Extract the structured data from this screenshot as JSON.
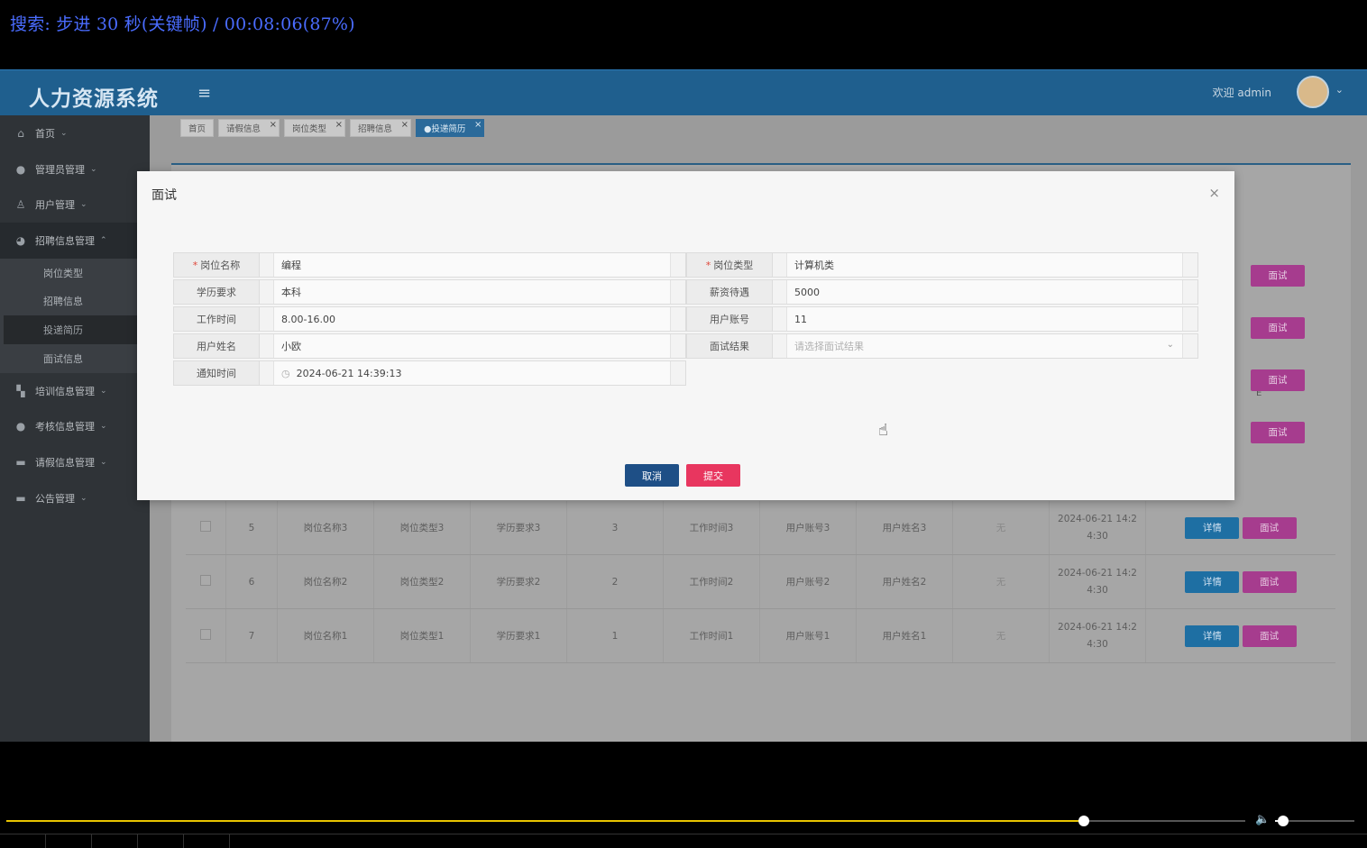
{
  "player": {
    "osd_text": "搜索: 步进 30 秒(关键帧) / 00:08:06(87%)",
    "progress": 0.87,
    "volume": 0.1
  },
  "app": {
    "brand": "人力资源系统",
    "welcome": "欢迎 admin"
  },
  "sidebar": {
    "items": [
      {
        "label": "首页",
        "icon": "home-icon"
      },
      {
        "label": "管理员管理",
        "icon": "admin-icon"
      },
      {
        "label": "用户管理",
        "icon": "user-icon"
      },
      {
        "label": "招聘信息管理",
        "icon": "recruit-icon"
      },
      {
        "label": "培训信息管理",
        "icon": "training-icon"
      },
      {
        "label": "考核信息管理",
        "icon": "assessment-icon"
      },
      {
        "label": "请假信息管理",
        "icon": "leave-icon"
      },
      {
        "label": "公告管理",
        "icon": "notice-icon"
      }
    ],
    "submenu": [
      "岗位类型",
      "招聘信息",
      "投递简历",
      "面试信息"
    ]
  },
  "tabs": [
    {
      "label": "首页"
    },
    {
      "label": "请假信息"
    },
    {
      "label": "岗位类型"
    },
    {
      "label": "招聘信息"
    },
    {
      "label": "●投递简历"
    }
  ],
  "table": {
    "header_fragment": "E",
    "rows": [
      {
        "id": "5",
        "name": "岗位名称3",
        "type": "岗位类型3",
        "edu": "学历要求3",
        "salary": "3",
        "time": "工作时间3",
        "account": "用户账号3",
        "uname": "用户姓名3",
        "status": "无",
        "date1": "2024-06-21 14:2",
        "date2": "4:30"
      },
      {
        "id": "6",
        "name": "岗位名称2",
        "type": "岗位类型2",
        "edu": "学历要求2",
        "salary": "2",
        "time": "工作时间2",
        "account": "用户账号2",
        "uname": "用户姓名2",
        "status": "无",
        "date1": "2024-06-21 14:2",
        "date2": "4:30"
      },
      {
        "id": "7",
        "name": "岗位名称1",
        "type": "岗位类型1",
        "edu": "学历要求1",
        "salary": "1",
        "time": "工作时间1",
        "account": "用户账号1",
        "uname": "用户姓名1",
        "status": "无",
        "date1": "2024-06-21 14:2",
        "date2": "4:30"
      }
    ],
    "detail_label": "详情",
    "interview_label": "面试"
  },
  "modal": {
    "title": "面试",
    "close": "×",
    "fields": {
      "position_name": {
        "label": "岗位名称",
        "value": "编程"
      },
      "position_type": {
        "label": "岗位类型",
        "value": "计算机类"
      },
      "education": {
        "label": "学历要求",
        "value": "本科"
      },
      "salary": {
        "label": "薪资待遇",
        "value": "5000"
      },
      "work_time": {
        "label": "工作时间",
        "value": "8.00-16.00"
      },
      "user_account": {
        "label": "用户账号",
        "value": "11"
      },
      "user_name": {
        "label": "用户姓名",
        "value": "小欧"
      },
      "result": {
        "label": "面试结果",
        "placeholder": "请选择面试结果"
      },
      "notice_time": {
        "label": "通知时间",
        "value": "2024-06-21 14:39:13"
      }
    },
    "cancel": "取消",
    "submit": "提交"
  },
  "colors": {
    "topbar": "#1f5f8e",
    "cancel_button": "#1e4f86",
    "submit_button": "#e8365f",
    "progress": "#e8c400"
  }
}
